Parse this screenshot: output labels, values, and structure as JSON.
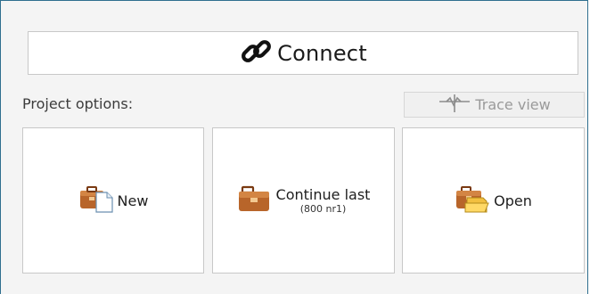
{
  "connect": {
    "label": "Connect",
    "icon": "link-icon"
  },
  "project_options": {
    "label": "Project options:"
  },
  "trace_view": {
    "label": "Trace view",
    "icon": "trace-icon",
    "enabled": false
  },
  "tiles": [
    {
      "label": "New",
      "icon": "new-project-icon"
    },
    {
      "label": "Continue last",
      "sublabel": "(800 nr1)",
      "icon": "briefcase-icon"
    },
    {
      "label": "Open",
      "icon": "open-project-icon"
    }
  ],
  "colors": {
    "window_border": "#2f6f8f",
    "briefcase": "#b8652a",
    "briefcase_dark": "#7a3a12",
    "disabled_text": "#9a9a9a"
  }
}
